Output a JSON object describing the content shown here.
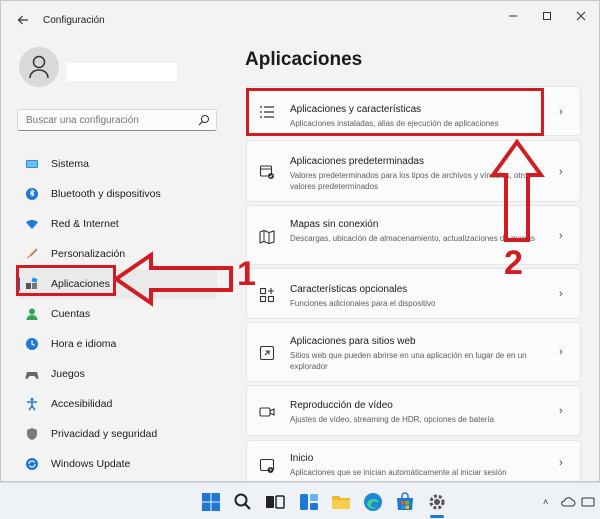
{
  "window": {
    "title": "Configuración"
  },
  "search": {
    "placeholder": "Buscar una configuración"
  },
  "sidebar": {
    "items": [
      {
        "label": "Sistema"
      },
      {
        "label": "Bluetooth y dispositivos"
      },
      {
        "label": "Red & Internet"
      },
      {
        "label": "Personalización"
      },
      {
        "label": "Aplicaciones"
      },
      {
        "label": "Cuentas"
      },
      {
        "label": "Hora e idioma"
      },
      {
        "label": "Juegos"
      },
      {
        "label": "Accesibilidad"
      },
      {
        "label": "Privacidad y seguridad"
      },
      {
        "label": "Windows Update"
      }
    ],
    "selected": "Aplicaciones"
  },
  "main": {
    "title": "Aplicaciones",
    "cards": [
      {
        "title": "Aplicaciones y características",
        "desc": "Aplicaciones instaladas, alias de ejecución de aplicaciones"
      },
      {
        "title": "Aplicaciones predeterminadas",
        "desc": "Valores predeterminados para los tipos de archivos y vínculos, otros valores predeterminados"
      },
      {
        "title": "Mapas sin conexión",
        "desc": "Descargas, ubicación de almacenamiento, actualizaciones de mapas"
      },
      {
        "title": "Características opcionales",
        "desc": "Funciones adicionales para el dispositivo"
      },
      {
        "title": "Aplicaciones para sitios web",
        "desc": "Sitios web que pueden abrirse en una aplicación en lugar de en un explorador"
      },
      {
        "title": "Reproducción de vídeo",
        "desc": "Ajustes de vídeo, streaming de HDR, opciones de batería"
      },
      {
        "title": "Inicio",
        "desc": "Aplicaciones que se inician automáticamente al iniciar sesión"
      }
    ]
  },
  "annotations": {
    "step1": "1",
    "step2": "2",
    "color": "#d11c24"
  },
  "colors": {
    "accent": "#0067c0",
    "window_bg": "#f3f3f3",
    "card_bg": "#fbfbfb"
  }
}
